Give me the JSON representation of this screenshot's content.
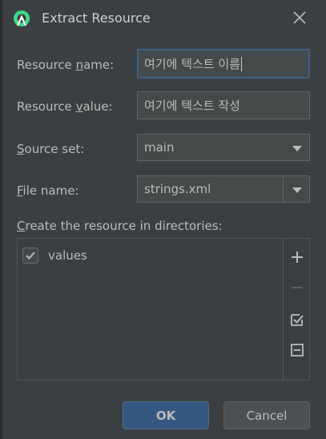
{
  "dialog": {
    "title": "Extract Resource",
    "icon": "android-studio-icon",
    "close_icon": "close-icon"
  },
  "form": {
    "resource_name": {
      "label_pre": "Resource ",
      "label_mnemonic": "n",
      "label_post": "ame:",
      "value": "여기에 텍스트 이름"
    },
    "resource_value": {
      "label_pre": "Resource ",
      "label_mnemonic": "v",
      "label_post": "alue:",
      "value": "여기에 텍스트 작성"
    },
    "source_set": {
      "label_pre": "",
      "label_mnemonic": "S",
      "label_post": "ource set:",
      "selected": "main"
    },
    "file_name": {
      "label_pre": "",
      "label_mnemonic": "F",
      "label_post": "ile name:",
      "selected": "strings.xml"
    },
    "directories": {
      "label_pre": "",
      "label_mnemonic": "C",
      "label_post": "reate the resource in directories:",
      "items": [
        {
          "label": "values",
          "checked": true
        }
      ]
    }
  },
  "toolbar": {
    "add_icon": "plus-icon",
    "remove_icon": "minus-icon",
    "select_all_icon": "check-all-icon",
    "unselect_all_icon": "uncheck-all-icon"
  },
  "buttons": {
    "ok_label": "OK",
    "cancel_label": "Cancel"
  },
  "colors": {
    "background": "#3c3f41",
    "field_bg": "#45494a",
    "focus_border": "#3d6185",
    "ok_button": "#365880",
    "android_green": "#3ddc84"
  }
}
